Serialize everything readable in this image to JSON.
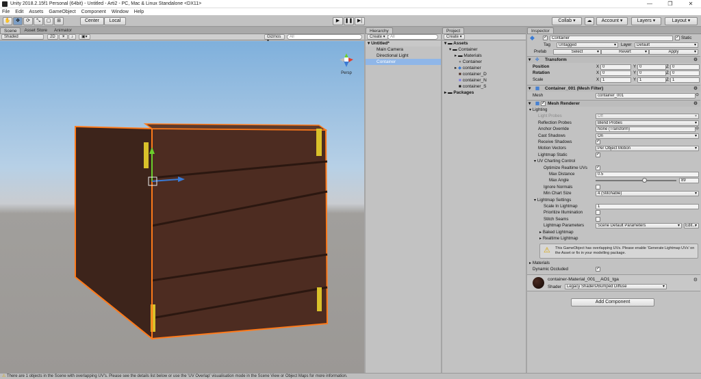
{
  "window": {
    "title": "Unity 2018.2.15f1 Personal (64bit) - Untitled - Arti2 - PC, Mac & Linux Standalone <DX11>",
    "min": "—",
    "max": "❐",
    "close": "✕"
  },
  "menu": [
    "File",
    "Edit",
    "Assets",
    "GameObject",
    "Component",
    "Window",
    "Help"
  ],
  "toolbar": {
    "center": "Center",
    "local": "Local",
    "collab": "Collab ▾",
    "account": "Account ▾",
    "layers": "Layers ▾",
    "layout": "Layout ▾",
    "cloud_icon": "cloud-icon"
  },
  "scene": {
    "tabs": [
      "Scene",
      "Asset Store",
      "Animator"
    ],
    "shaded": "Shaded",
    "mode2d": "2D",
    "gizmos": "Gizmos ▾",
    "search": "All",
    "persp": "Persp"
  },
  "hierarchy": {
    "tab": "Hierarchy",
    "create": "Create ▾",
    "search": "All",
    "scene": "Untitled*",
    "items": [
      "Main Camera",
      "Directional Light",
      "Container"
    ]
  },
  "project": {
    "tab": "Project",
    "create": "Create ▾",
    "assets": "Assets",
    "container_folder": "Container",
    "items": [
      "Materials",
      "Container",
      "container",
      "container_D",
      "container_N",
      "container_S"
    ],
    "packages": "Packages"
  },
  "inspector": {
    "tab": "Inspector",
    "name": "Container",
    "static": "Static",
    "tag_label": "Tag",
    "tag": "Untagged",
    "layer_label": "Layer",
    "layer": "Default",
    "prefab_label": "Prefab",
    "select": "Select",
    "revert": "Revert",
    "apply": "Apply",
    "transform": {
      "title": "Transform",
      "position": "Position",
      "rotation": "Rotation",
      "scale": "Scale",
      "pos": [
        "0",
        "0",
        "0"
      ],
      "rot": [
        "0",
        "0",
        "0"
      ],
      "scl": [
        "1",
        "1",
        "1"
      ],
      "axes": [
        "X",
        "Y",
        "Z"
      ]
    },
    "meshfilter": {
      "title": "Container_001 (Mesh Filter)",
      "mesh_label": "Mesh",
      "mesh": "container_001"
    },
    "renderer": {
      "title": "Mesh Renderer",
      "lighting": "Lighting",
      "light_probes": "Light Probes",
      "light_probes_v": "Off",
      "reflection": "Reflection Probes",
      "reflection_v": "Blend Probes",
      "anchor": "Anchor Override",
      "anchor_v": "None (Transform)",
      "cast": "Cast Shadows",
      "cast_v": "On",
      "receive": "Receive Shadows",
      "motion": "Motion Vectors",
      "motion_v": "Per Object Motion",
      "lm_static": "Lightmap Static",
      "uv_chart": "UV Charting Control",
      "opt_uvs": "Optimize Realtime UVs",
      "max_dist": "Max Distance",
      "max_dist_v": "0.5",
      "max_angle": "Max Angle",
      "max_angle_v": "89",
      "max_angle_frac": 0.6,
      "ignore_normals": "Ignore Normals",
      "min_chart": "Min Chart Size",
      "min_chart_v": "4 (Stitchable)",
      "lm_settings": "Lightmap Settings",
      "scale_lm": "Scale In Lightmap",
      "scale_lm_v": "1",
      "prioritize": "Prioritize Illumination",
      "stitch": "Stitch Seams",
      "lm_params": "Lightmap Parameters",
      "lm_params_v": "Scene Default Parameters",
      "edit": "Edit...",
      "baked": "Baked Lightmap",
      "realtime": "Realtime Lightmap",
      "warning": "This GameObject has overlapping UVs. Please enable 'Generate Lightmap UVs' on the Asset or fix in your modelling package.",
      "materials": "Materials",
      "occluded": "Dynamic Occluded"
    },
    "material": {
      "name": "container-Material_001__AO1_tga",
      "shader_label": "Shader",
      "shader": "Legacy Shaders/Bumped Diffuse"
    },
    "add_component": "Add Component"
  },
  "status": "There are 1 objects in the Scene with overlapping UV's. Please see the details list below or use the 'UV Overlap' visualisation mode in the Scene View or Object Maps for more information.",
  "colors": {
    "accent": "#3a7bd5",
    "selection": "#ff7a1a",
    "sky": "#9cc4e6",
    "ground": "#9a9794"
  }
}
